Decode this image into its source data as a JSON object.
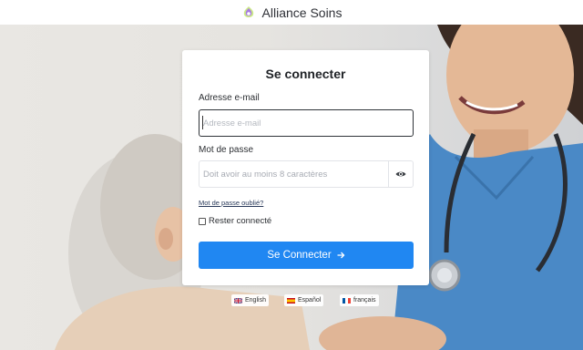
{
  "brand": {
    "name": "Alliance Soins"
  },
  "login": {
    "title": "Se connecter",
    "email_label": "Adresse e-mail",
    "email_placeholder": "Adresse e-mail",
    "password_label": "Mot de passe",
    "password_placeholder": "Doit avoir au moins 8 caractères",
    "forgot_link": "Mot de passe oublié?",
    "remember_label": "Rester connecté",
    "remember_checked": false,
    "submit_label": "Se Connecter"
  },
  "languages": [
    {
      "label": "English",
      "flag": "uk-flag-icon"
    },
    {
      "label": "Español",
      "flag": "spain-flag-icon"
    },
    {
      "label": "français",
      "flag": "france-flag-icon"
    }
  ],
  "colors": {
    "primary": "#2087f2",
    "scrub": "#4a89c6"
  }
}
